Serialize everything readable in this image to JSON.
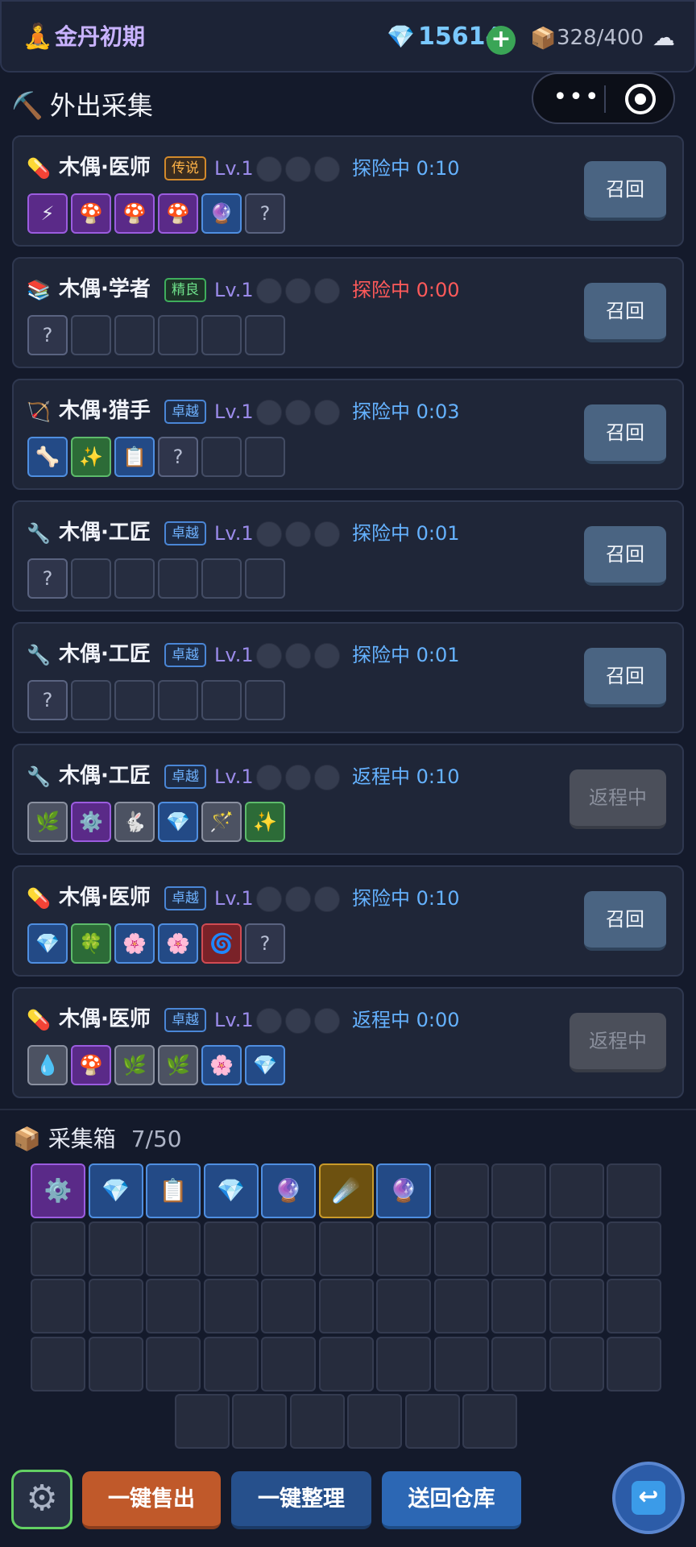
{
  "header": {
    "realm_icon": "meditation-icon",
    "realm": "金丹初期",
    "gems": "15614",
    "gem_add": "+",
    "bag_capacity": "328/400",
    "colors": {
      "gem": "#79c8ff",
      "realm": "#c9b3ff",
      "add": "#3aa556"
    }
  },
  "capsule": {
    "more": "•••"
  },
  "section": {
    "icon": "⛏️",
    "title": "外出采集"
  },
  "workers": [
    {
      "icon": "💊",
      "name": "木偶·医师",
      "rank": "传说",
      "rank_type": "legend",
      "level": "Lv.1",
      "status": "探险中 0:10",
      "status_type": "normal",
      "action": "召回",
      "action_type": "recall",
      "items": [
        {
          "g": "⚡",
          "c": "purple"
        },
        {
          "g": "🍄",
          "c": "purple"
        },
        {
          "g": "🍄",
          "c": "purple"
        },
        {
          "g": "🍄",
          "c": "purple"
        },
        {
          "g": "🔮",
          "c": "blue"
        },
        {
          "g": "?",
          "c": "q"
        }
      ]
    },
    {
      "icon": "📚",
      "name": "木偶·学者",
      "rank": "精良",
      "rank_type": "elite",
      "level": "Lv.1",
      "status": "探险中 0:00",
      "status_type": "warn",
      "action": "召回",
      "action_type": "recall",
      "items": [
        {
          "g": "?",
          "c": "q"
        },
        {
          "g": "",
          "c": ""
        },
        {
          "g": "",
          "c": ""
        },
        {
          "g": "",
          "c": ""
        },
        {
          "g": "",
          "c": ""
        },
        {
          "g": "",
          "c": ""
        }
      ]
    },
    {
      "icon": "🏹",
      "name": "木偶·猎手",
      "rank": "卓越",
      "rank_type": "excel",
      "level": "Lv.1",
      "status": "探险中 0:03",
      "status_type": "normal",
      "action": "召回",
      "action_type": "recall",
      "items": [
        {
          "g": "🦴",
          "c": "blue"
        },
        {
          "g": "✨",
          "c": "green"
        },
        {
          "g": "📋",
          "c": "blue"
        },
        {
          "g": "?",
          "c": "q"
        },
        {
          "g": "",
          "c": ""
        },
        {
          "g": "",
          "c": ""
        }
      ]
    },
    {
      "icon": "🔧",
      "name": "木偶·工匠",
      "rank": "卓越",
      "rank_type": "excel",
      "level": "Lv.1",
      "status": "探险中 0:01",
      "status_type": "normal",
      "action": "召回",
      "action_type": "recall",
      "items": [
        {
          "g": "?",
          "c": "q"
        },
        {
          "g": "",
          "c": ""
        },
        {
          "g": "",
          "c": ""
        },
        {
          "g": "",
          "c": ""
        },
        {
          "g": "",
          "c": ""
        },
        {
          "g": "",
          "c": ""
        }
      ]
    },
    {
      "icon": "🔧",
      "name": "木偶·工匠",
      "rank": "卓越",
      "rank_type": "excel",
      "level": "Lv.1",
      "status": "探险中 0:01",
      "status_type": "normal",
      "action": "召回",
      "action_type": "recall",
      "items": [
        {
          "g": "?",
          "c": "q"
        },
        {
          "g": "",
          "c": ""
        },
        {
          "g": "",
          "c": ""
        },
        {
          "g": "",
          "c": ""
        },
        {
          "g": "",
          "c": ""
        },
        {
          "g": "",
          "c": ""
        }
      ]
    },
    {
      "icon": "🔧",
      "name": "木偶·工匠",
      "rank": "卓越",
      "rank_type": "excel",
      "level": "Lv.1",
      "status": "返程中 0:10",
      "status_type": "normal",
      "action": "返程中",
      "action_type": "returning",
      "items": [
        {
          "g": "🌿",
          "c": "gray"
        },
        {
          "g": "⚙️",
          "c": "purple"
        },
        {
          "g": "🐇",
          "c": "gray"
        },
        {
          "g": "💎",
          "c": "blue"
        },
        {
          "g": "🪄",
          "c": "gray"
        },
        {
          "g": "✨",
          "c": "green"
        }
      ]
    },
    {
      "icon": "💊",
      "name": "木偶·医师",
      "rank": "卓越",
      "rank_type": "excel",
      "level": "Lv.1",
      "status": "探险中 0:10",
      "status_type": "normal",
      "action": "召回",
      "action_type": "recall",
      "items": [
        {
          "g": "💎",
          "c": "blue"
        },
        {
          "g": "🍀",
          "c": "green"
        },
        {
          "g": "🌸",
          "c": "blue"
        },
        {
          "g": "🌸",
          "c": "blue"
        },
        {
          "g": "🌀",
          "c": "red"
        },
        {
          "g": "?",
          "c": "q"
        }
      ]
    },
    {
      "icon": "💊",
      "name": "木偶·医师",
      "rank": "卓越",
      "rank_type": "excel",
      "level": "Lv.1",
      "status": "返程中 0:00",
      "status_type": "normal",
      "action": "返程中",
      "action_type": "returning",
      "items": [
        {
          "g": "💧",
          "c": "gray"
        },
        {
          "g": "🍄",
          "c": "purple"
        },
        {
          "g": "🌿",
          "c": "gray"
        },
        {
          "g": "🌿",
          "c": "gray"
        },
        {
          "g": "🌸",
          "c": "blue"
        },
        {
          "g": "💎",
          "c": "blue"
        }
      ]
    }
  ],
  "box": {
    "icon": "📦",
    "title": "采集箱",
    "count": "7/50",
    "items": [
      {
        "g": "⚙️",
        "c": "purple"
      },
      {
        "g": "💎",
        "c": "blue"
      },
      {
        "g": "📋",
        "c": "blue"
      },
      {
        "g": "💎",
        "c": "blue"
      },
      {
        "g": "🔮",
        "c": "blue"
      },
      {
        "g": "☄️",
        "c": "gold"
      },
      {
        "g": "🔮",
        "c": "blue"
      }
    ]
  },
  "bottom": {
    "settings_icon": "⚙",
    "sell": "一键售出",
    "sort": "一键整理",
    "send_back": "送回仓库",
    "return_icon": "↩"
  }
}
